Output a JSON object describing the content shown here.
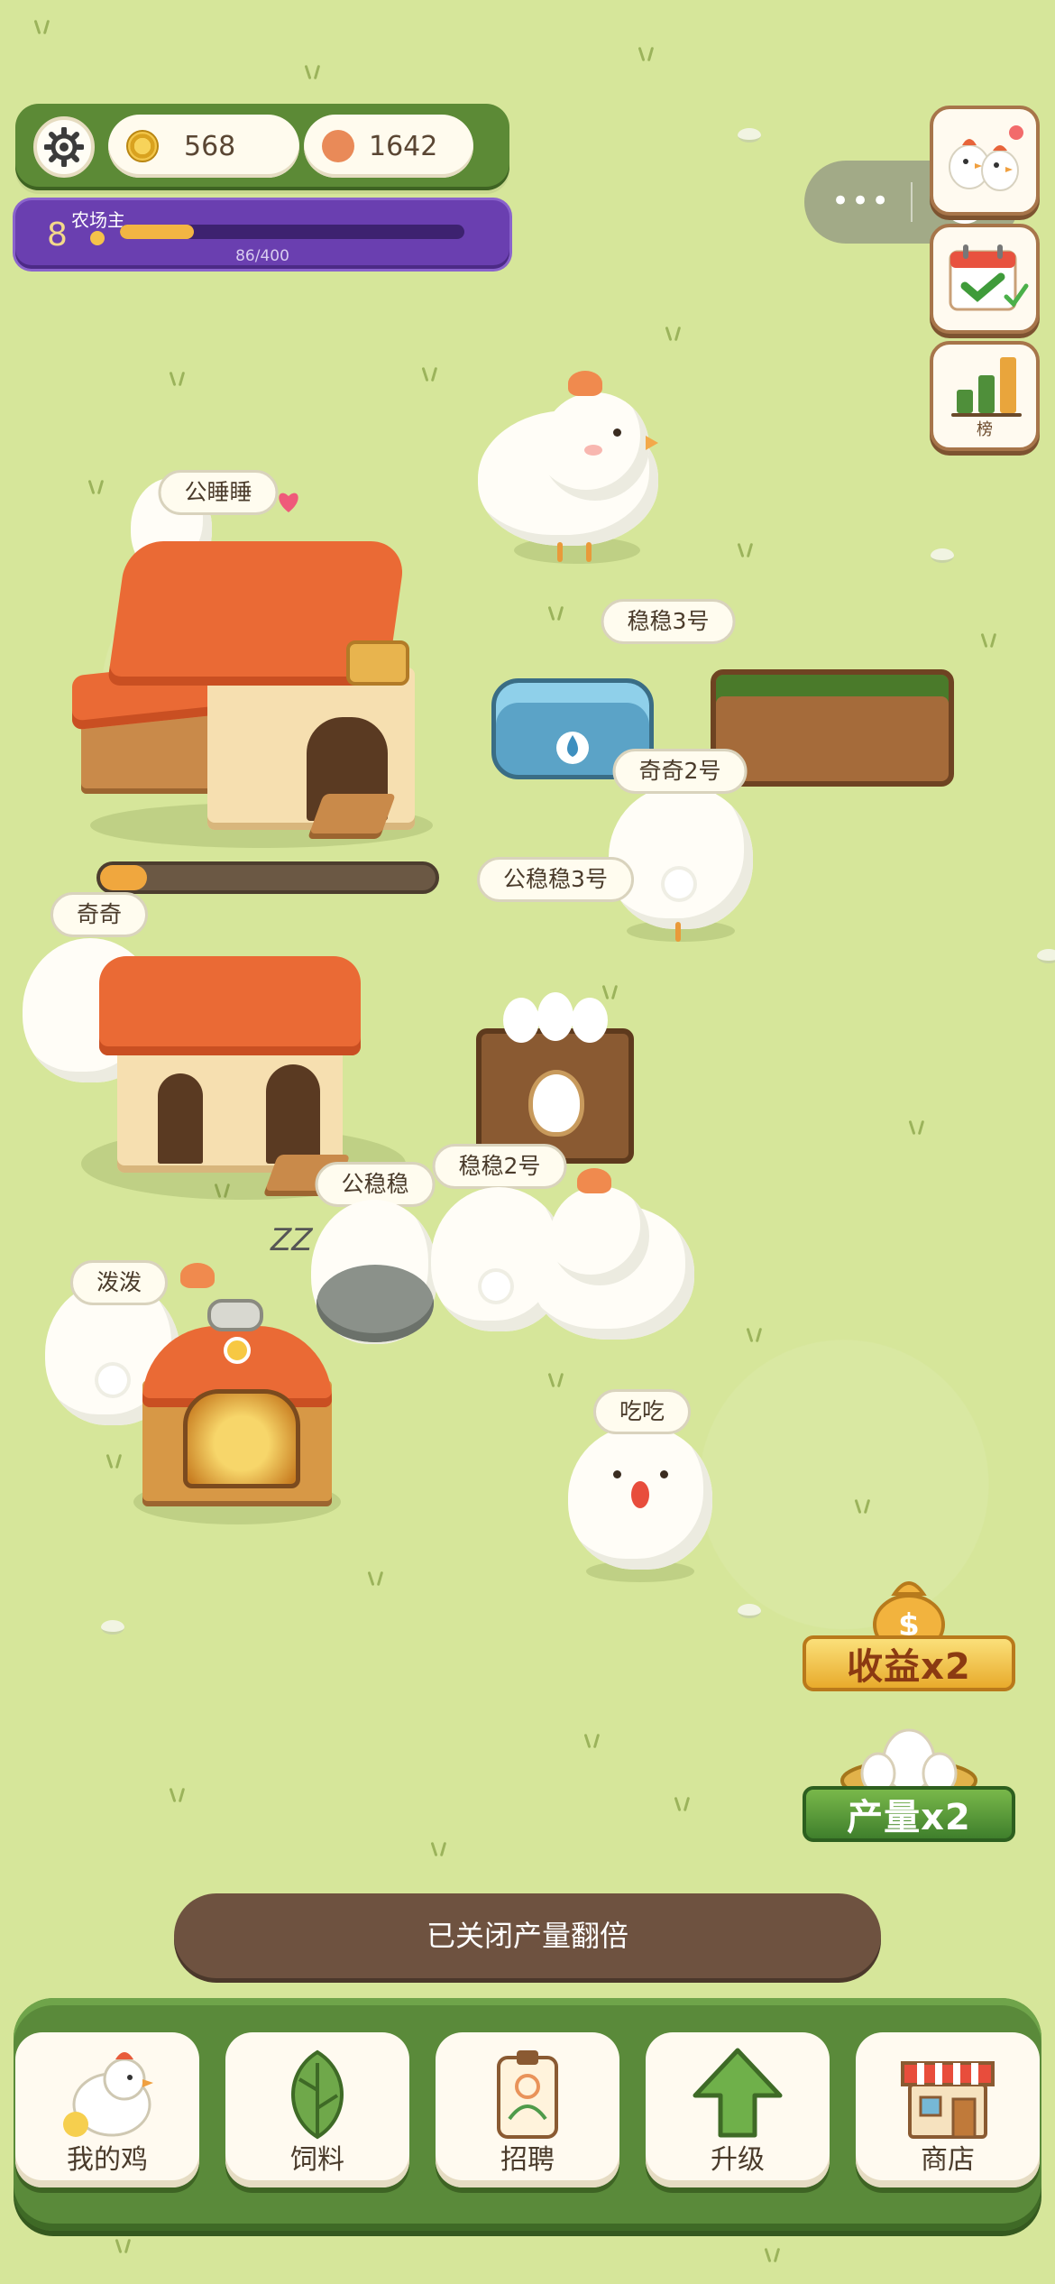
{
  "hud": {
    "coins": "568",
    "gems": "1642",
    "level": "8",
    "level_title": "农场主",
    "xp_text": "86/400",
    "xp_current": 86,
    "xp_max": 400
  },
  "side_buttons": [
    {
      "icon": "chickens-family-icon"
    },
    {
      "icon": "calendar-checkin-icon"
    },
    {
      "icon": "leaderboard-icon",
      "label": "榜"
    }
  ],
  "miniprogram_capsule": {
    "more": "•••"
  },
  "name_tags": {
    "gongshuishui": "公睡睡",
    "wenwen3": "稳稳3号",
    "qiqi2": "奇奇2号",
    "gongwenwen3": "公稳稳3号",
    "qiqi": "奇奇",
    "gongwenwen": "公稳稳",
    "wenwen2": "稳稳2号",
    "bobo": "泼泼",
    "chichi": "吃吃"
  },
  "coop_progress": 0.14,
  "sleep_text": "ZZ",
  "bonuses": {
    "income": "收益x2",
    "output": "产量x2"
  },
  "toast": "已关闭产量翻倍",
  "nav": [
    {
      "label": "我的鸡",
      "icon": "chicken-icon"
    },
    {
      "label": "饲料",
      "icon": "leaf-icon"
    },
    {
      "label": "招聘",
      "icon": "id-badge-icon"
    },
    {
      "label": "升级",
      "icon": "up-arrow-icon"
    },
    {
      "label": "商店",
      "icon": "shop-icon"
    }
  ],
  "colors": {
    "grass": "#d6e69a",
    "hud_green": "#5c8a36",
    "level_purple": "#6a3fb0",
    "toast_brown": "#6e5240",
    "roof_orange": "#ea6a35"
  }
}
